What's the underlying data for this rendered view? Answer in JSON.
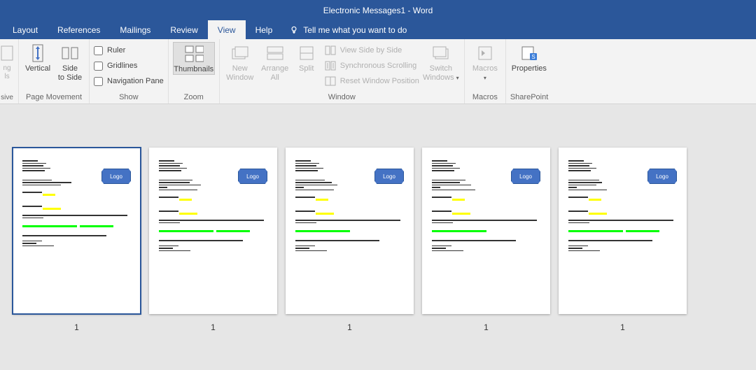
{
  "titlebar": {
    "title": "Electronic Messages1  -  Word"
  },
  "tabs": {
    "items": [
      {
        "label": "Layout"
      },
      {
        "label": "References"
      },
      {
        "label": "Mailings"
      },
      {
        "label": "Review"
      },
      {
        "label": "View",
        "active": true
      },
      {
        "label": "Help"
      }
    ],
    "tellme_placeholder": "Tell me what you want to do"
  },
  "ribbon": {
    "page_movement": {
      "label": "Page Movement",
      "vertical": "Vertical",
      "side": "Side\nto Side"
    },
    "show": {
      "label": "Show",
      "ruler": "Ruler",
      "gridlines": "Gridlines",
      "navpane": "Navigation Pane"
    },
    "zoom": {
      "label": "Zoom",
      "thumbnails": "Thumbnails"
    },
    "window": {
      "label": "Window",
      "new_window": "New\nWindow",
      "arrange_all": "Arrange\nAll",
      "split": "Split",
      "side_by_side": "View Side by Side",
      "sync_scroll": "Synchronous Scrolling",
      "reset_pos": "Reset Window Position",
      "switch": "Switch\nWindows"
    },
    "macros": {
      "label": "Macros",
      "btn": "Macros"
    },
    "sharepoint": {
      "label": "SharePoint",
      "btn": "Properties"
    }
  },
  "thumbs": {
    "logo_text": "Logo",
    "pages": [
      {
        "num": "1",
        "selected": true
      },
      {
        "num": "1"
      },
      {
        "num": "1"
      },
      {
        "num": "1"
      },
      {
        "num": "1"
      }
    ]
  }
}
